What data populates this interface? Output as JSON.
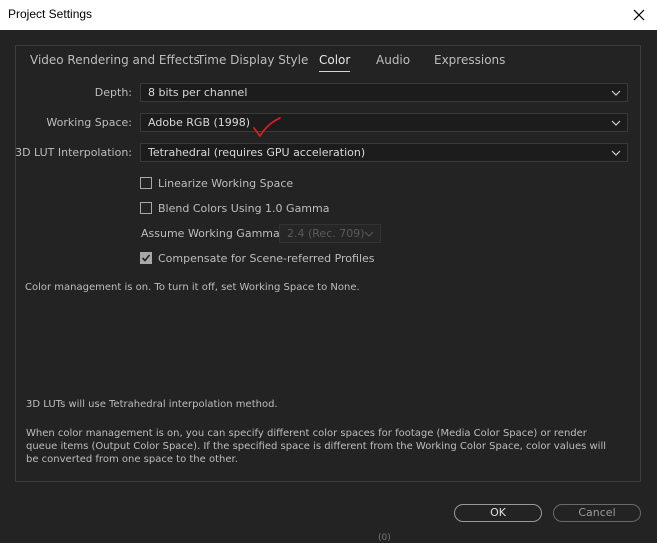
{
  "window": {
    "title": "Project Settings"
  },
  "tabs": [
    {
      "label": "Video Rendering and Effects"
    },
    {
      "label": "Time Display Style"
    },
    {
      "label": "Color",
      "active": true
    },
    {
      "label": "Audio"
    },
    {
      "label": "Expressions"
    }
  ],
  "settings": {
    "depth": {
      "label": "Depth:",
      "value": "8 bits per channel"
    },
    "working_space": {
      "label": "Working Space:",
      "value": "Adobe RGB (1998)"
    },
    "lut": {
      "label": "3D LUT Interpolation:",
      "value": "Tetrahedral (requires GPU acceleration)"
    },
    "linearize": {
      "label": "Linearize Working Space",
      "checked": false
    },
    "blend": {
      "label": "Blend Colors Using 1.0 Gamma",
      "checked": false
    },
    "gamma": {
      "label": "Assume Working Gamma:",
      "value": "2.4 (Rec. 709)",
      "enabled": false
    },
    "compensate": {
      "label": "Compensate for Scene-referred Profiles",
      "checked": true
    }
  },
  "info": {
    "status": "Color management is on. To turn it off, set Working Space to None.",
    "lut_note": "3D LUTs will use Tetrahedral interpolation method.",
    "description": "When color management is on, you can specify different color spaces for footage (Media Color Space) or render queue items (Output Color Space). If the specified space is different from the Working Color Space, color values will be converted from one space to the other."
  },
  "buttons": {
    "ok": "OK",
    "cancel": "Cancel"
  },
  "annotation": {
    "color": "#e02020"
  },
  "fragment": "(0)",
  "icons": {
    "close": "close-icon",
    "chevron": "chevron-down-icon",
    "check": "checkmark-icon"
  }
}
